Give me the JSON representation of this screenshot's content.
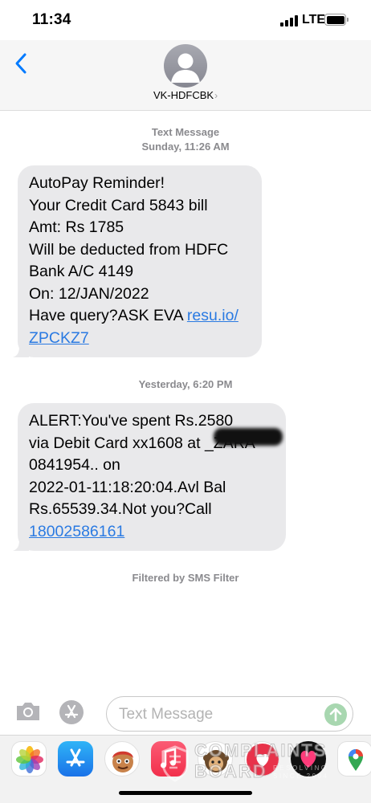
{
  "status": {
    "time": "11:34",
    "network": "LTE"
  },
  "header": {
    "back_label": "Back",
    "contact_name": "VK-HDFCBK",
    "contact_chevron": "›"
  },
  "messages_area": {
    "stamp1_type": "Text Message",
    "stamp1_time": "Sunday, 11:26 AM",
    "msg1_lines": [
      "AutoPay Reminder!",
      "Your Credit Card 5843 bill",
      "Amt: Rs 1785",
      "Will be deducted from HDFC",
      "Bank A/C 4149",
      "On: 12/JAN/2022",
      "Have query?ASK EVA"
    ],
    "msg1_link_part1": "resu.io/",
    "msg1_link_part2": "ZPCKZ7",
    "stamp2_time": "Yesterday, 6:20 PM",
    "msg2_lines": [
      "ALERT:You've spent Rs.2580",
      "via Debit Card xx1608 at _ZARA",
      "0841954.. on",
      "2022-01-11:18:20:04.Avl Bal",
      "Rs.65539.34.Not you?Call"
    ],
    "msg2_link": "18002586161",
    "filter_note": "Filtered by SMS Filter"
  },
  "input_bar": {
    "placeholder": "Text Message"
  },
  "app_strip": {
    "apps": [
      "photos-icon",
      "app-store-icon",
      "memoji-icon",
      "music-icon",
      "memoji2-icon",
      "digital-touch-icon",
      "fitness-icon",
      "maps-icon"
    ]
  },
  "watermark": {
    "line1": "COMPLAINTS",
    "line2": "BOARD",
    "tagline1": "RESOLVING",
    "tagline2": "SINCE 2004"
  },
  "colors": {
    "bubble": "#e9e9eb",
    "link": "#2a7ae2",
    "meta": "#8a8a8e",
    "accent": "#007aff"
  }
}
